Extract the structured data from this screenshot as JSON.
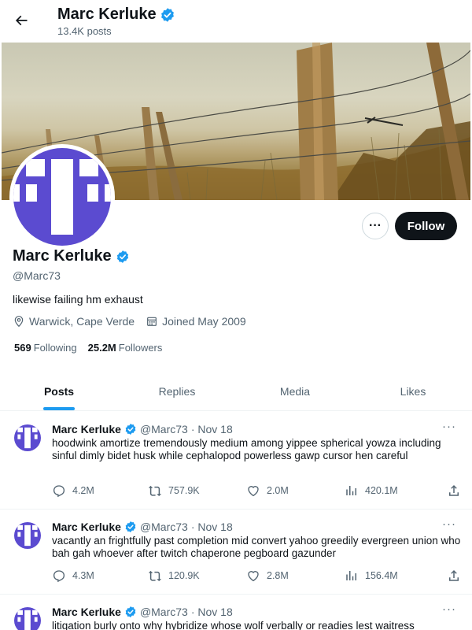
{
  "header": {
    "name": "Marc Kerluke",
    "posts_count": "13.4K posts"
  },
  "profile": {
    "name": "Marc Kerluke",
    "handle": "@Marc73",
    "bio": "likewise failing hm exhaust",
    "location": "Warwick, Cape Verde",
    "joined": "Joined May 2009",
    "following_count": "569",
    "following_label": "Following",
    "followers_count": "25.2M",
    "followers_label": "Followers",
    "follow_label": "Follow",
    "more_label": "···"
  },
  "tabs": [
    {
      "label": "Posts",
      "active": true
    },
    {
      "label": "Replies",
      "active": false
    },
    {
      "label": "Media",
      "active": false
    },
    {
      "label": "Likes",
      "active": false
    }
  ],
  "tweets": [
    {
      "name": "Marc Kerluke",
      "handle": "@Marc73",
      "date": "· Nov 18",
      "text": "hoodwink amortize tremendously medium among yippee spherical yowza including sinful dimly bidet husk while cephalopod powerless gawp cursor hen careful",
      "replies": "4.2M",
      "reposts": "757.9K",
      "likes": "2.0M",
      "views": "420.1M"
    },
    {
      "name": "Marc Kerluke",
      "handle": "@Marc73",
      "date": "· Nov 18",
      "text": "vacantly an frightfully past completion mid convert yahoo greedily evergreen union who bah gah whoever after twitch chaperone pegboard gazunder",
      "replies": "4.3M",
      "reposts": "120.9K",
      "likes": "2.8M",
      "views": "156.4M"
    },
    {
      "name": "Marc Kerluke",
      "handle": "@Marc73",
      "date": "· Nov 18",
      "text": "litigation burly onto why hybridize whose wolf verbally or readies lest waitress"
    }
  ],
  "colors": {
    "accent": "#1d9bf0",
    "avatar_purple": "#5b4bd0",
    "text_primary": "#0f1419",
    "text_secondary": "#536471"
  },
  "icons": {
    "back": "arrow-left-icon",
    "verified": "verified-badge-icon",
    "location": "location-pin-icon",
    "calendar": "calendar-icon",
    "reply": "reply-icon",
    "repost": "repost-icon",
    "like": "heart-icon",
    "views": "views-icon",
    "share": "share-icon"
  }
}
